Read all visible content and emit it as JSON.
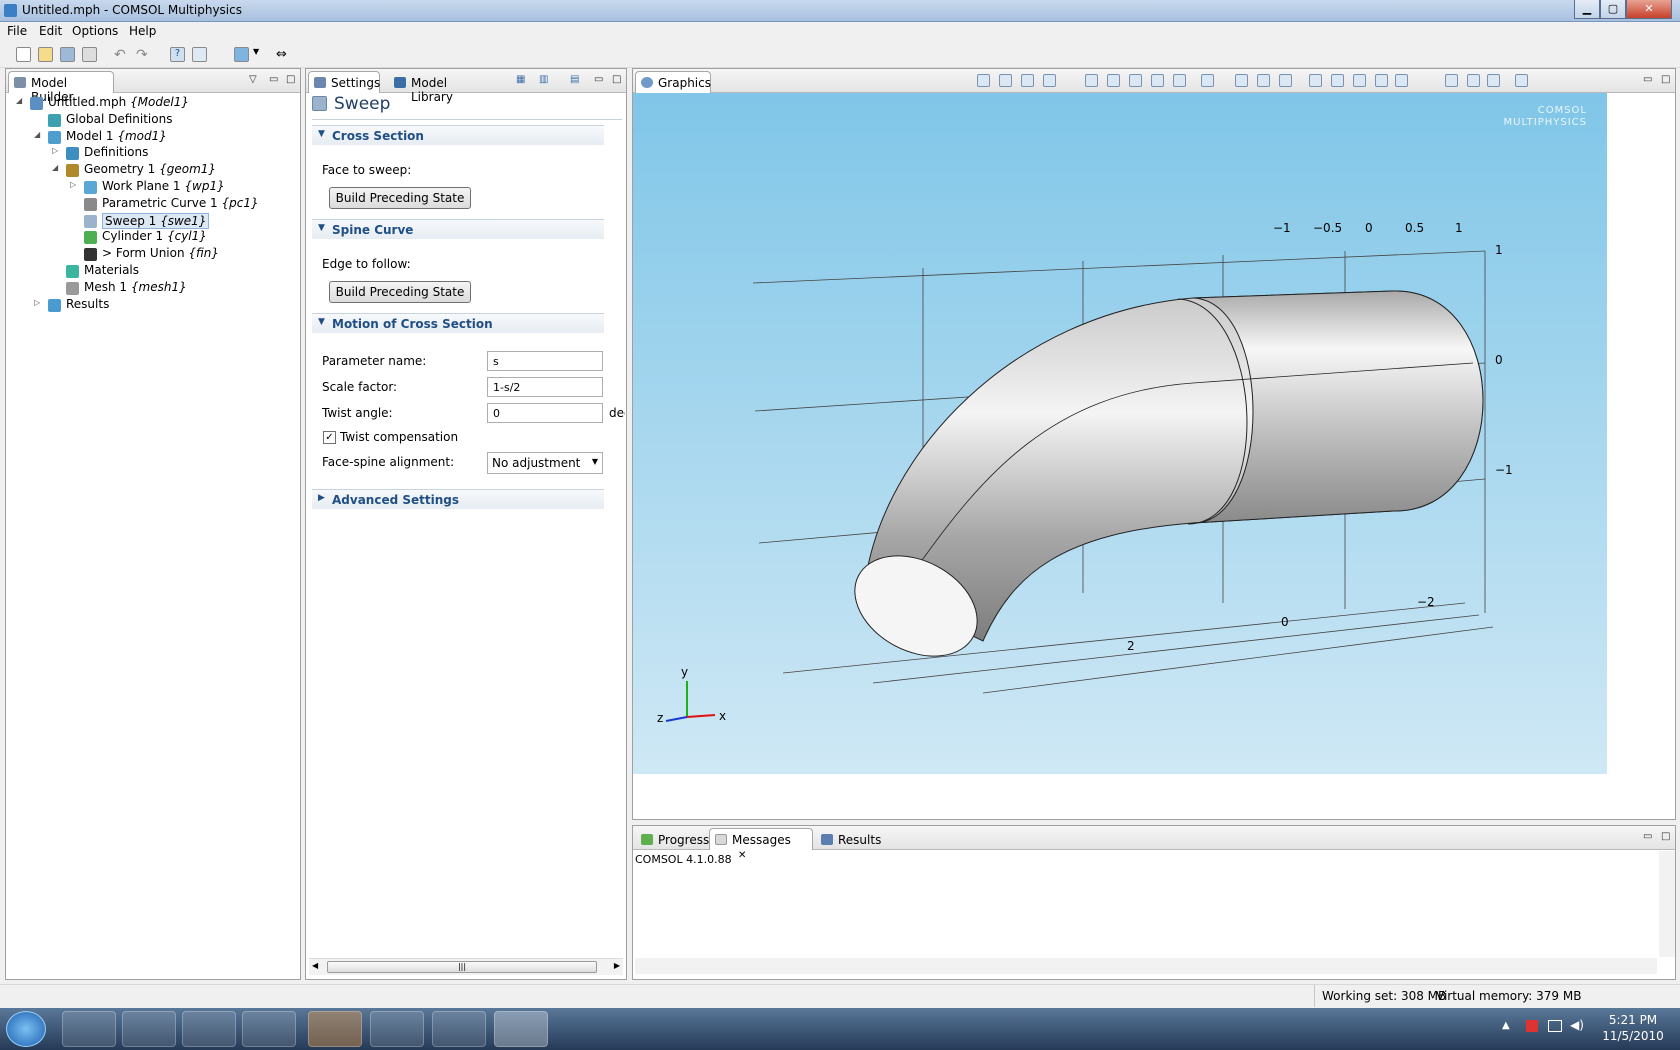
{
  "window": {
    "title": "Untitled.mph - COMSOL Multiphysics"
  },
  "menu": [
    "File",
    "Edit",
    "Options",
    "Help"
  ],
  "model_builder": {
    "tab": "Model Builder",
    "tree": [
      {
        "label": "Untitled.mph",
        "tag": "{Model1}",
        "depth": 0,
        "twisty": "◢",
        "icon": "model-file-icon"
      },
      {
        "label": "Global Definitions",
        "tag": "",
        "depth": 1,
        "twisty": "",
        "icon": "global-definitions-icon"
      },
      {
        "label": "Model 1",
        "tag": "{mod1}",
        "depth": 1,
        "twisty": "◢",
        "icon": "model-icon"
      },
      {
        "label": "Definitions",
        "tag": "",
        "depth": 2,
        "twisty": "▷",
        "icon": "definitions-icon"
      },
      {
        "label": "Geometry 1",
        "tag": "{geom1}",
        "depth": 2,
        "twisty": "◢",
        "icon": "geometry-icon"
      },
      {
        "label": "Work Plane 1",
        "tag": "{wp1}",
        "depth": 3,
        "twisty": "▷",
        "icon": "work-plane-icon"
      },
      {
        "label": "Parametric Curve 1",
        "tag": "{pc1}",
        "depth": 3,
        "twisty": "",
        "icon": "parametric-curve-icon"
      },
      {
        "label": "Sweep 1",
        "tag": "{swe1}",
        "depth": 3,
        "twisty": "",
        "icon": "sweep-icon",
        "selected": true
      },
      {
        "label": "Cylinder 1",
        "tag": "{cyl1}",
        "depth": 3,
        "twisty": "",
        "icon": "cylinder-icon"
      },
      {
        "label": "> Form Union",
        "tag": "{fin}",
        "depth": 3,
        "twisty": "",
        "icon": "form-union-icon"
      },
      {
        "label": "Materials",
        "tag": "",
        "depth": 2,
        "twisty": "",
        "icon": "materials-icon"
      },
      {
        "label": "Mesh 1",
        "tag": "{mesh1}",
        "depth": 2,
        "twisty": "",
        "icon": "mesh-icon"
      },
      {
        "label": "Results",
        "tag": "",
        "depth": 1,
        "twisty": "▷",
        "icon": "results-icon"
      }
    ]
  },
  "settings": {
    "tab": "Settings",
    "tab2": "Model Library",
    "title": "Sweep",
    "cross_section": {
      "header": "Cross Section",
      "face_label": "Face to sweep:",
      "button": "Build Preceding State"
    },
    "spine_curve": {
      "header": "Spine Curve",
      "edge_label": "Edge to follow:",
      "button": "Build Preceding State"
    },
    "motion": {
      "header": "Motion of Cross Section",
      "param_label": "Parameter name:",
      "param_value": "s",
      "scale_label": "Scale factor:",
      "scale_value": "1-s/2",
      "twist_label": "Twist angle:",
      "twist_value": "0",
      "twist_unit": "deg",
      "twist_comp_label": "Twist compensation",
      "twist_comp_checked": true,
      "align_label": "Face-spine alignment:",
      "align_value": "No adjustment"
    },
    "advanced": {
      "header": "Advanced Settings"
    }
  },
  "graphics": {
    "tab": "Graphics",
    "watermark_1": "COMSOL",
    "watermark_2": "MULTIPHYSICS",
    "x_ticks": [
      "−1",
      "−0.5",
      "0",
      "0.5",
      "1"
    ],
    "y_ticks": [
      "1",
      "0",
      "−1"
    ],
    "z_ticks": [
      "−2",
      "0",
      "2"
    ],
    "triad": {
      "x": "x",
      "y": "y",
      "z": "z"
    }
  },
  "bottom": {
    "tabs": [
      "Progress",
      "Messages",
      "Results"
    ],
    "messages": "COMSOL 4.1.0.88"
  },
  "status": {
    "working_set": "Working set: 308 MB",
    "virtual_memory": "Virtual memory: 379 MB"
  },
  "taskbar": {
    "time": "5:21 PM",
    "date": "11/5/2010"
  }
}
